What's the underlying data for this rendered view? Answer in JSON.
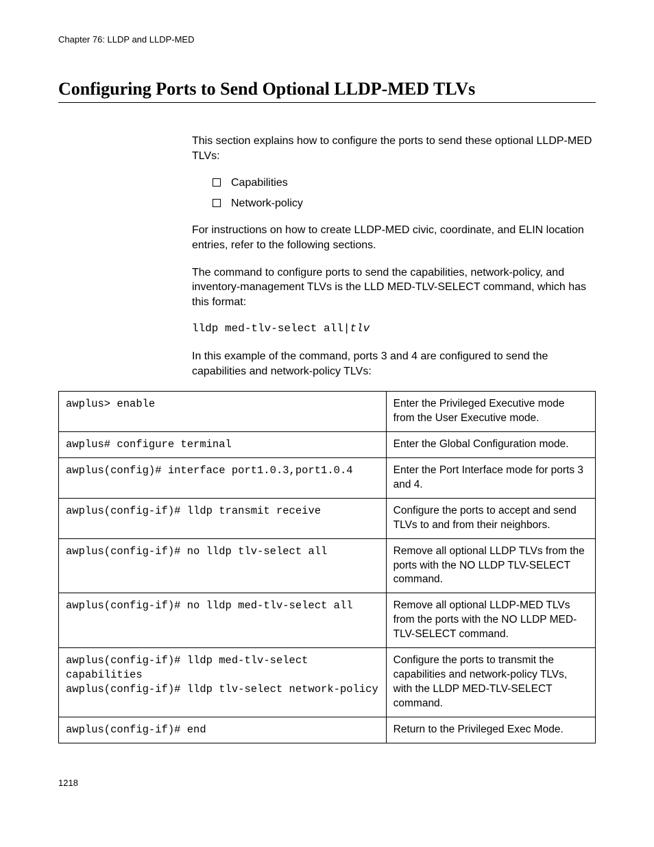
{
  "chapter_header": "Chapter 76: LLDP and LLDP-MED",
  "section_title": "Configuring Ports to Send Optional LLDP-MED TLVs",
  "intro_para": "This section explains how to configure the ports to send these optional LLDP-MED TLVs:",
  "list_items": [
    "Capabilities",
    "Network-policy"
  ],
  "para2": "For instructions on how to create LLDP-MED civic, coordinate, and ELIN location entries, refer to the following sections.",
  "para3": "The command to configure ports to send the capabilities, network-policy, and inventory-management TLVs is the LLD MED-TLV-SELECT command, which has this format:",
  "command_syntax_prefix": "lldp med-tlv-select all|",
  "command_syntax_italic": "tlv",
  "para4": "In this example of the command, ports 3 and 4 are configured to send the capabilities and network-policy TLVs:",
  "table_rows": [
    {
      "cmd": "awplus> enable",
      "desc": "Enter the Privileged Executive mode from the User Executive mode."
    },
    {
      "cmd": "awplus# configure terminal",
      "desc": "Enter the Global Configuration mode."
    },
    {
      "cmd": "awplus(config)# interface port1.0.3,port1.0.4",
      "desc": "Enter the Port Interface mode for ports 3 and 4."
    },
    {
      "cmd": "awplus(config-if)# lldp transmit receive",
      "desc": "Configure the ports to accept and send TLVs to and from their neighbors."
    },
    {
      "cmd": "awplus(config-if)# no lldp tlv-select all",
      "desc": "Remove all optional LLDP TLVs from the ports with the NO LLDP TLV-SELECT command."
    },
    {
      "cmd": "awplus(config-if)# no lldp med-tlv-select all",
      "desc": "Remove all optional LLDP-MED TLVs from the ports with the NO LLDP MED-TLV-SELECT command."
    },
    {
      "cmd": "awplus(config-if)# lldp med-tlv-select capabilities\nawplus(config-if)# lldp tlv-select network-policy",
      "desc": "Configure the ports to transmit the capabilities and network-policy TLVs, with the LLDP MED-TLV-SELECT command."
    },
    {
      "cmd": "awplus(config-if)# end",
      "desc": "Return to the Privileged Exec Mode."
    }
  ],
  "page_number": "1218"
}
